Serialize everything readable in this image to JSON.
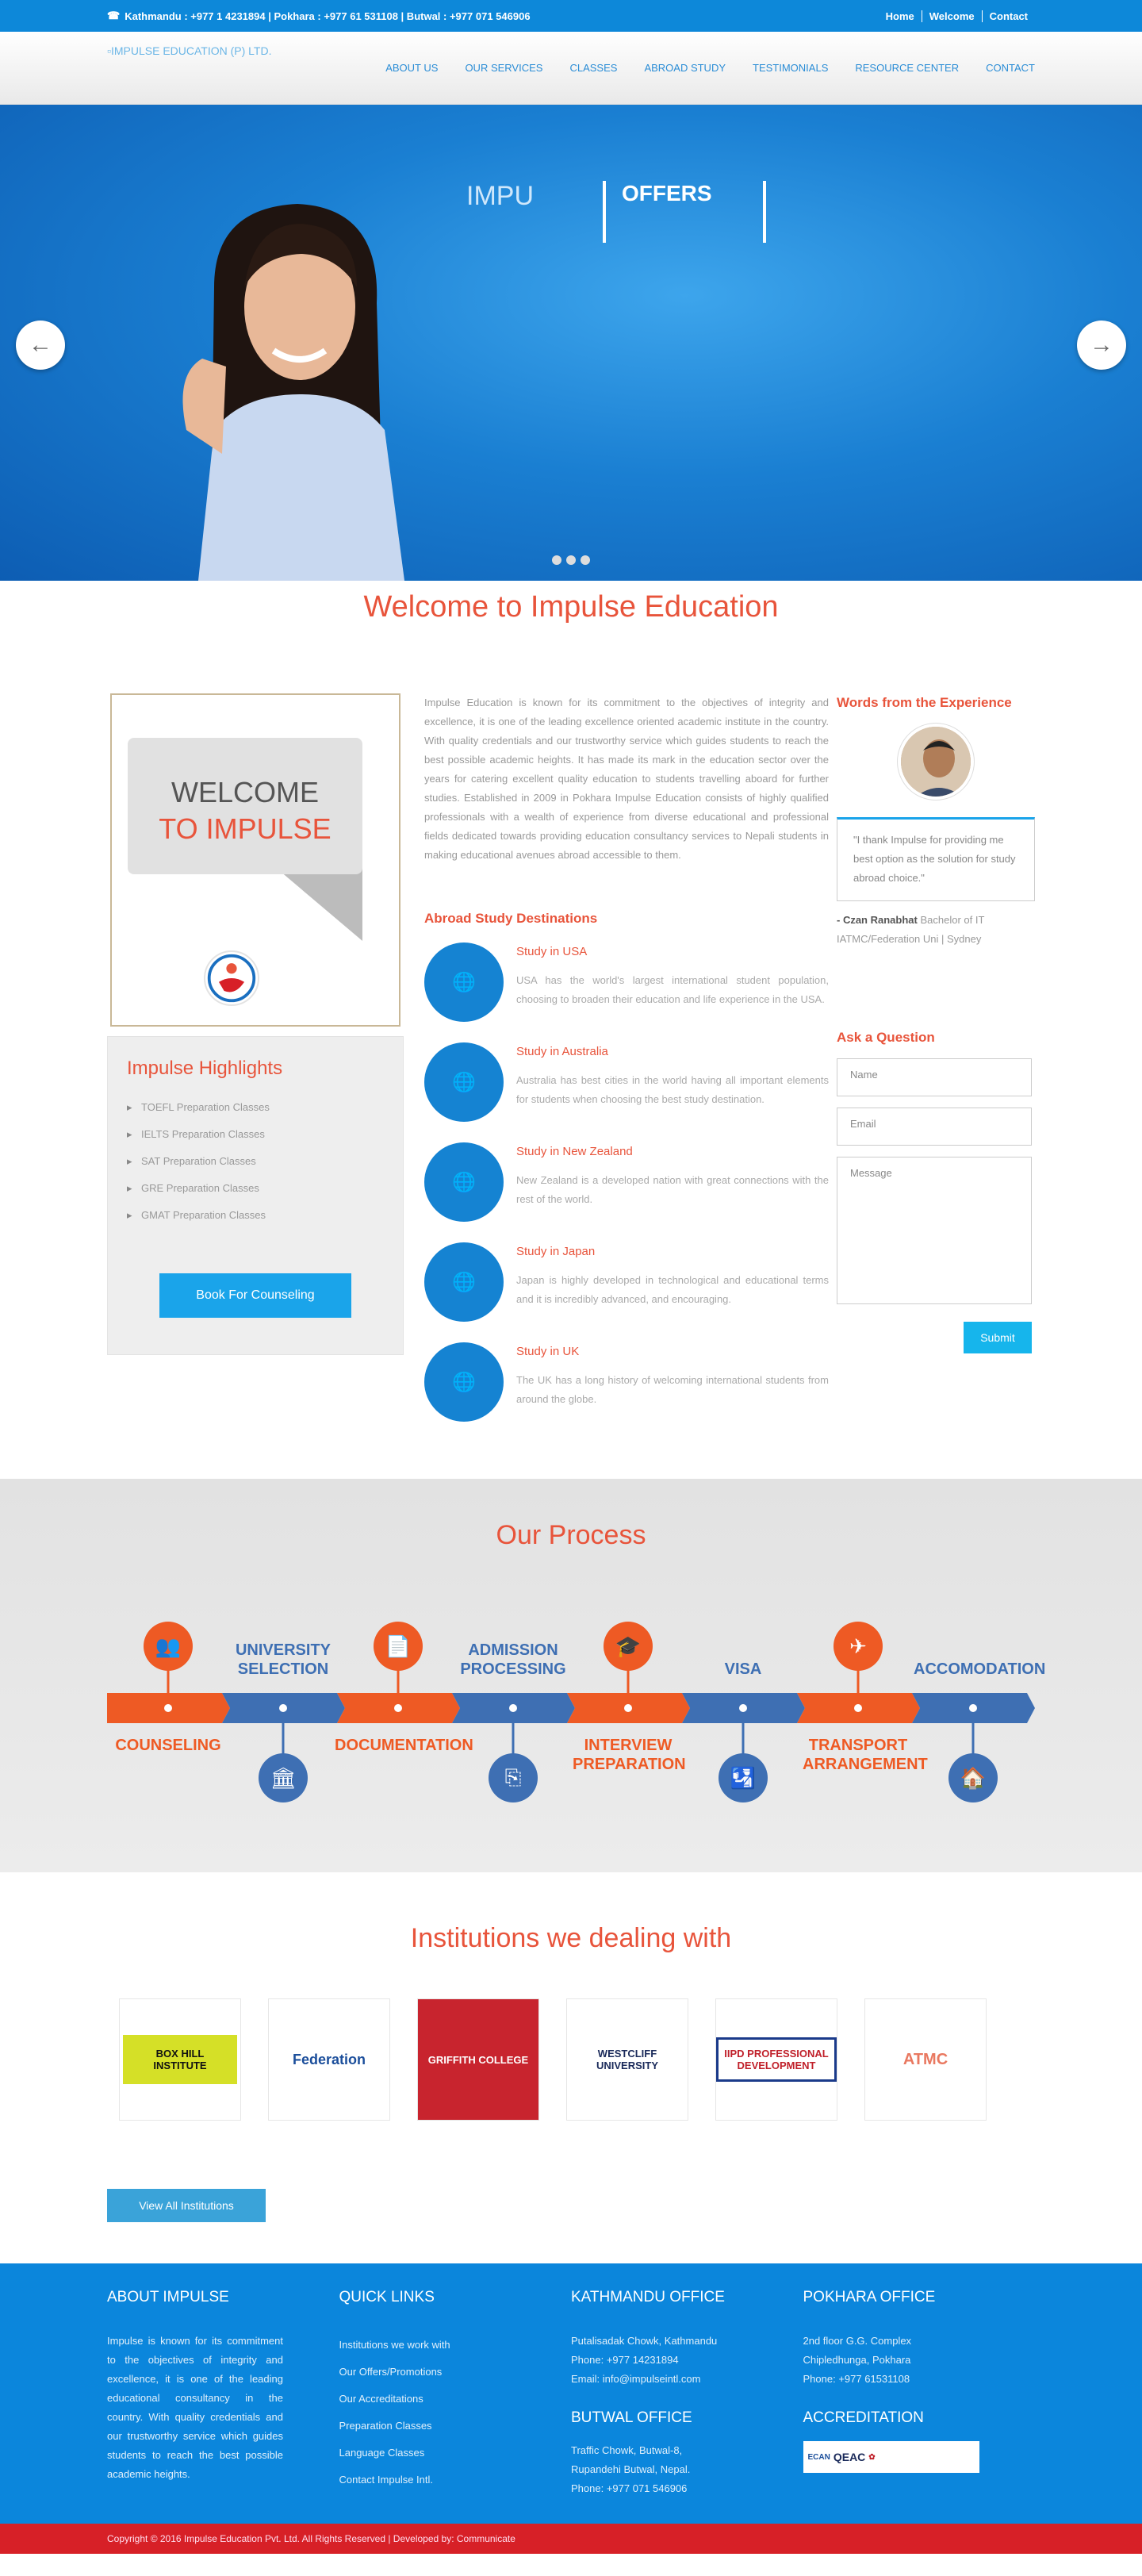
{
  "topbar": {
    "contact": "Kathmandu : +977 1 4231894 | Pokhara : +977 61 531108 | Butwal : +977 071 546906",
    "links": [
      "Home",
      "Welcome",
      "Contact"
    ]
  },
  "header": {
    "logo_alt": "IMPULSE EDUCATION (P) LTD.",
    "nav": [
      "ABOUT US",
      "OUR SERVICES",
      "CLASSES",
      "ABROAD STUDY",
      "TESTIMONIALS",
      "RESOURCE CENTER",
      "CONTACT"
    ]
  },
  "hero": {
    "text": "IMPU",
    "offers": "OFFERS",
    "prev": "←",
    "next": "→"
  },
  "welcome_title": "Welcome to Impulse Education",
  "welcome_box": {
    "line1": "WELCOME",
    "line2": "TO IMPULSE"
  },
  "highlights": {
    "title": "Impulse Highlights",
    "items": [
      "TOEFL Preparation Classes",
      "IELTS Preparation Classes",
      "SAT Preparation Classes",
      "GRE Preparation Classes",
      "GMAT Preparation Classes"
    ],
    "button": "Book For Counseling"
  },
  "about": "Impulse Education is known for its commitment to the objectives of integrity and excellence, it is one of the leading excellence oriented academic institute in the country. With quality credentials and our trustworthy service which guides students to reach the best possible academic heights. It has made its mark in the education sector over the years for catering excellent quality education to students travelling aboard for further studies. Established in 2009 in Pokhara Impulse Education consists of highly qualified professionals with a wealth of experience from diverse educational and professional fields dedicated towards providing education consultancy services to Nepali students in making educational avenues abroad accessible to them.",
  "destinations": {
    "title": "Abroad Study Destinations",
    "items": [
      {
        "name": "Study in USA",
        "desc": "USA has the world's largest international student population, choosing to broaden their education and life experience in the USA."
      },
      {
        "name": "Study in Australia",
        "desc": "Australia has best cities in the world having all important elements for students when choosing the best study destination."
      },
      {
        "name": "Study in New Zealand",
        "desc": "New Zealand is a developed nation with great connections with the rest of the world."
      },
      {
        "name": "Study in Japan",
        "desc": "Japan is highly developed in technological and educational terms and it is incredibly advanced, and encouraging."
      },
      {
        "name": "Study in UK",
        "desc": "The UK has a long history of welcoming international students from around the globe."
      }
    ]
  },
  "testimonial": {
    "title": "Words from the Experience",
    "quote": "\"I thank Impulse for providing me best option as the solution for study abroad choice.\"",
    "author": "- Czan Ranabhat",
    "detail": "Bachelor of IT IATMC/Federation Uni | Sydney"
  },
  "ask": {
    "title": "Ask a Question",
    "name": "Name",
    "email": "Email",
    "message": "Message",
    "submit": "Submit"
  },
  "process": {
    "title": "Our Process",
    "steps": [
      "COUNSELING",
      "UNIVERSITY SELECTION",
      "DOCUMENTATION",
      "ADMISSION PROCESSING",
      "INTERVIEW PREPARATION",
      "VISA",
      "TRANSPORT ARRANGEMENT",
      "ACCOMODATION"
    ]
  },
  "institutions": {
    "title": "Institutions we dealing with",
    "logos": [
      "BOX HILL INSTITUTE",
      "Federation",
      "GRIFFITH COLLEGE",
      "WESTCLIFF UNIVERSITY",
      "IIPD PROFESSIONAL DEVELOPMENT",
      "ATMC"
    ],
    "button": "View All Institutions"
  },
  "footer": {
    "about_title": "ABOUT IMPULSE",
    "about": "Impulse is known for its commitment to the objectives of integrity and excellence, it is one of the leading educational consultancy in the country. With quality credentials and our trustworthy service which guides students to reach the best possible academic heights.",
    "links_title": "QUICK LINKS",
    "links": [
      "Institutions we work with",
      "Our Offers/Promotions",
      "Our Accreditations",
      "Preparation Classes",
      "Language Classes",
      "Contact Impulse Intl."
    ],
    "ktm_title": "KATHMANDU OFFICE",
    "ktm": [
      "Putalisadak Chowk, Kathmandu",
      "Phone: +977 14231894",
      "Email: info@impulseintl.com"
    ],
    "butwal_title": "BUTWAL OFFICE",
    "butwal": [
      "Traffic Chowk, Butwal-8,",
      "Rupandehi Butwal, Nepal.",
      "Phone: +977 071 546906"
    ],
    "pkr_title": "POKHARA OFFICE",
    "pkr": [
      "2nd floor G.G. Complex",
      "Chipledhunga, Pokhara",
      "Phone: +977 61531108"
    ],
    "accr_title": "ACCREDITATION",
    "accr": [
      "ECAN",
      "QEAC"
    ]
  },
  "copyright": "Copyright © 2016 Impulse Education Pvt. Ltd. All Rights Reserved | Developed by: Communicate",
  "colors": {
    "blue": "#0d88d9",
    "orange": "#e8543b",
    "red": "#d72027",
    "process_orange": "#ee5a24",
    "process_blue": "#3e6fb3"
  }
}
